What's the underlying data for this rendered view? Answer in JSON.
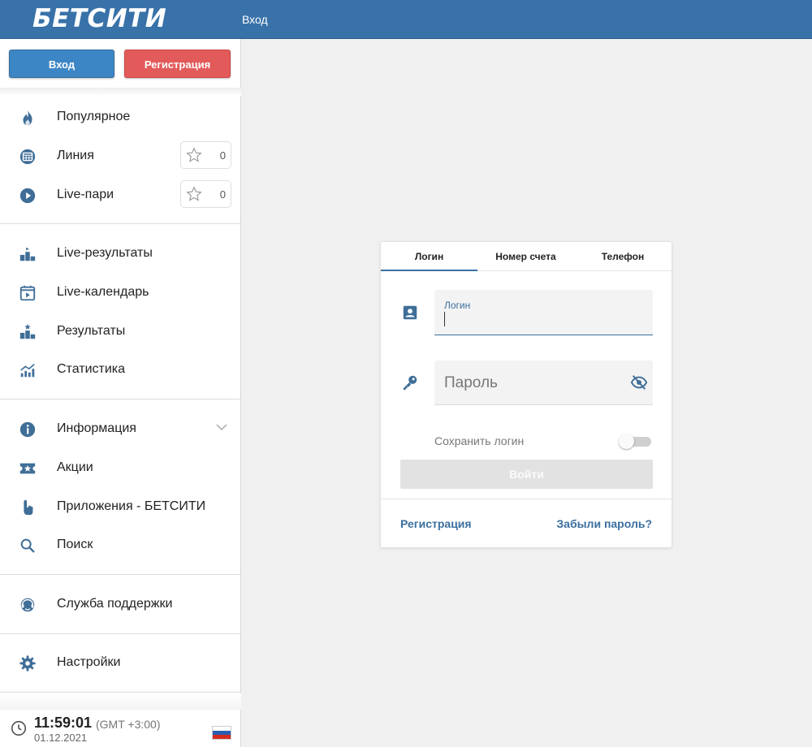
{
  "header": {
    "logo": "БЕТСИТИ",
    "login_link": "Вход"
  },
  "sidebar": {
    "login_button": "Вход",
    "register_button": "Регистрация",
    "items": [
      {
        "label": "Популярное",
        "icon": "fire-icon"
      },
      {
        "label": "Линия",
        "icon": "calendar-grid-icon",
        "favorites": "0"
      },
      {
        "label": "Live-пари",
        "icon": "play-circle-icon",
        "favorites": "0"
      },
      {
        "label": "Live-результаты",
        "icon": "podium-icon"
      },
      {
        "label": "Live-календарь",
        "icon": "calendar-play-icon"
      },
      {
        "label": "Результаты",
        "icon": "podium-star-icon"
      },
      {
        "label": "Статистика",
        "icon": "chart-icon"
      },
      {
        "label": "Информация",
        "icon": "info-icon"
      },
      {
        "label": "Акции",
        "icon": "ticket-star-icon"
      },
      {
        "label": "Приложения - БЕТСИТИ",
        "icon": "touch-icon"
      },
      {
        "label": "Поиск",
        "icon": "search-icon"
      },
      {
        "label": "Служба поддержки",
        "icon": "support-icon"
      },
      {
        "label": "Настройки",
        "icon": "gear-icon"
      }
    ],
    "clock": {
      "time": "11:59:01",
      "timezone": "(GMT +3:00)",
      "date": "01.12.2021"
    }
  },
  "login_form": {
    "tabs": [
      "Логин",
      "Номер счета",
      "Телефон"
    ],
    "active_tab": "Логин",
    "login_label": "Логин",
    "password_placeholder": "Пароль",
    "save_login_label": "Сохранить логин",
    "submit_label": "Войти",
    "register_link": "Регистрация",
    "forgot_link": "Забыли пароль?"
  },
  "colors": {
    "header": "#3872a8",
    "login_button": "#3d86c5",
    "register_button": "#e35a5a",
    "icon": "#3f6e97",
    "accent": "#3a6f9f"
  }
}
